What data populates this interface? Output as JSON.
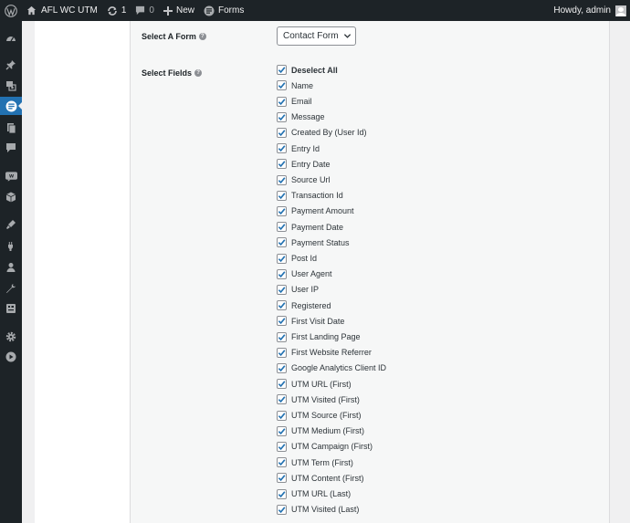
{
  "admin_bar": {
    "wp_logo": "wordpress-icon",
    "site_name": "AFL WC UTM",
    "updates_count": "1",
    "comments_count": "0",
    "new_label": "New",
    "forms_label": "Forms",
    "howdy": "Howdy, admin"
  },
  "side_menu": {
    "icons": [
      "dashboard-icon",
      "pin-icon",
      "media-icon",
      "forms-icon",
      "pages-icon",
      "comments-icon",
      "woocommerce-icon",
      "products-icon",
      "appearance-icon",
      "plugins-icon",
      "users-icon",
      "tools-icon",
      "settings-icon",
      "cog-icon",
      "play-icon"
    ],
    "active": "forms-icon"
  },
  "form": {
    "select_form_label": "Select A Form",
    "select_form_value": "Contact Form",
    "select_fields_label": "Select Fields",
    "fields": [
      "Deselect All",
      "Name",
      "Email",
      "Message",
      "Created By (User Id)",
      "Entry Id",
      "Entry Date",
      "Source Url",
      "Transaction Id",
      "Payment Amount",
      "Payment Date",
      "Payment Status",
      "Post Id",
      "User Agent",
      "User IP",
      "Registered",
      "First Visit Date",
      "First Landing Page",
      "First Website Referrer",
      "Google Analytics Client ID",
      "UTM URL (First)",
      "UTM Visited (First)",
      "UTM Source (First)",
      "UTM Medium (First)",
      "UTM Campaign (First)",
      "UTM Term (First)",
      "UTM Content (First)",
      "UTM URL (Last)",
      "UTM Visited (Last)"
    ],
    "checked": true
  },
  "colors": {
    "adminbar_bg": "#1d2327",
    "accent": "#2271b1",
    "panel_bg": "#f6f7f7"
  }
}
